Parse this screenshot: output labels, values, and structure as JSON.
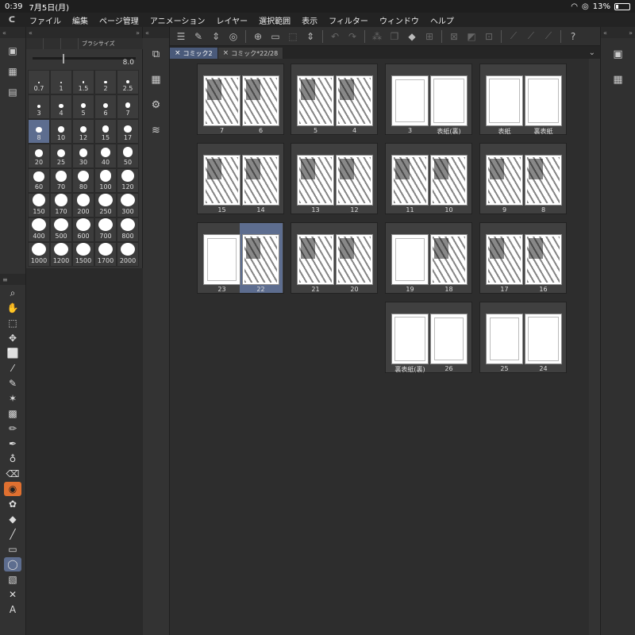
{
  "status": {
    "time": "0:39",
    "date": "7月5日(月)",
    "battery": "13%"
  },
  "menu": [
    "ファイル",
    "編集",
    "ページ管理",
    "アニメーション",
    "レイヤー",
    "選択範囲",
    "表示",
    "フィルター",
    "ウィンドウ",
    "ヘルプ"
  ],
  "brush": {
    "tab_label": "ブラシサイズ",
    "current_value": "8.0",
    "sizes": [
      "0.7",
      "1",
      "1.5",
      "2",
      "2.5",
      "3",
      "4",
      "5",
      "6",
      "7",
      "8",
      "10",
      "12",
      "15",
      "17",
      "20",
      "25",
      "30",
      "40",
      "50",
      "60",
      "70",
      "80",
      "100",
      "120",
      "150",
      "170",
      "200",
      "250",
      "300",
      "400",
      "500",
      "600",
      "700",
      "800",
      "1000",
      "1200",
      "1500",
      "1700",
      "2000"
    ],
    "selected_size": "8"
  },
  "tabs": [
    {
      "label": "コミック2",
      "active": true
    },
    {
      "label": "コミック*22/28",
      "active": false
    }
  ],
  "spreads": [
    {
      "left": "7",
      "right": "6"
    },
    {
      "left": "5",
      "right": "4"
    },
    {
      "left": "3",
      "right": "表紙(裏)"
    },
    {
      "left": "表紙",
      "right": "裏表紙"
    },
    {
      "left": "15",
      "right": "14"
    },
    {
      "left": "13",
      "right": "12"
    },
    {
      "left": "11",
      "right": "10"
    },
    {
      "left": "9",
      "right": "8"
    },
    {
      "left": "23",
      "right": "22"
    },
    {
      "left": "21",
      "right": "20"
    },
    {
      "left": "19",
      "right": "18"
    },
    {
      "left": "17",
      "right": "16"
    },
    {
      "left": "裏表紙(裏)",
      "right": "26"
    },
    {
      "left": "25",
      "right": "24"
    }
  ],
  "selected_page": "22"
}
